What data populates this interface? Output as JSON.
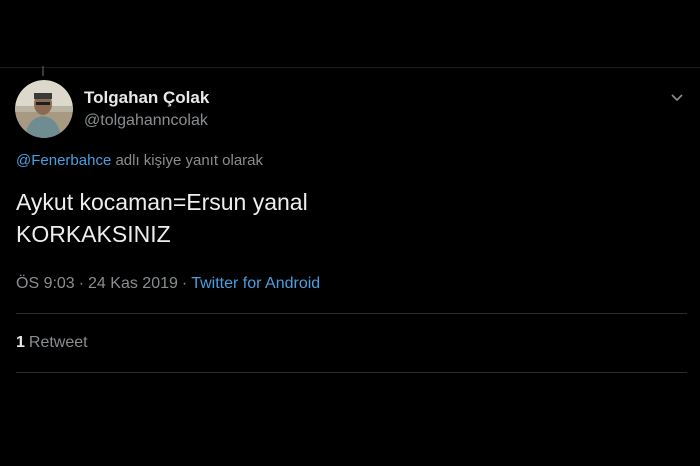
{
  "tweet": {
    "author": {
      "display_name": "Tolgahan Çolak",
      "handle": "@tolgahanncolak",
      "avatar_icon": "profile-photo"
    },
    "reply_context": {
      "mention": "@Fenerbahce",
      "suffix": " adlı kişiye yanıt olarak"
    },
    "text_lines": [
      "Aykut kocaman=Ersun yanal",
      "KORKAKSINIZ"
    ],
    "meta": {
      "time": "ÖS 9:03",
      "separator": "·",
      "date": "24 Kas 2019",
      "source": "Twitter for Android"
    },
    "stats": {
      "retweet_count": "1",
      "retweet_label": "Retweet"
    },
    "menu_icon": "chevron-down-icon"
  },
  "colors": {
    "background": "#000000",
    "primary_text": "#eeeeee",
    "secondary_text": "#8a8d90",
    "link": "#4a9fe0",
    "divider": "#2a2d30"
  }
}
